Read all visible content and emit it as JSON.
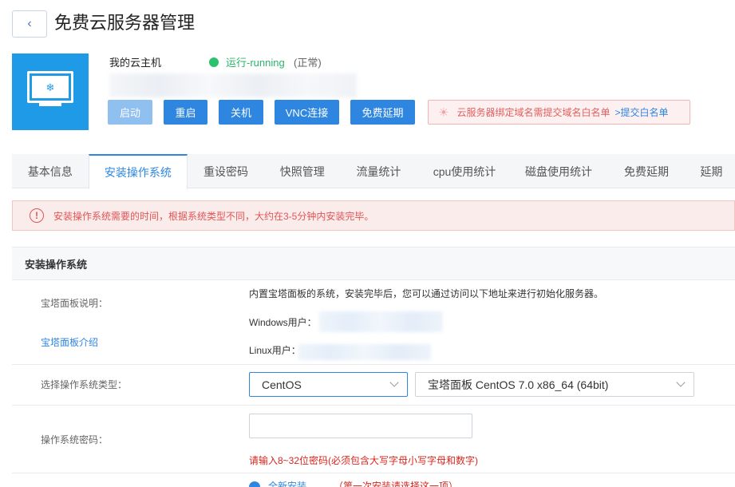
{
  "header": {
    "back_icon": "‹",
    "title": "免费云服务器管理"
  },
  "server": {
    "name": "我的云主机",
    "status": "运行-running",
    "status_note": "(正常)",
    "status_color": "#2bc26e"
  },
  "actions": {
    "start": "启动",
    "restart": "重启",
    "shutdown": "关机",
    "vnc": "VNC连接",
    "extend": "免费延期"
  },
  "notice": {
    "text": "云服务器绑定域名需提交域名白名单",
    "link": ">提交白名单"
  },
  "tabs": [
    {
      "label": "基本信息"
    },
    {
      "label": "安装操作系统",
      "active": true
    },
    {
      "label": "重设密码"
    },
    {
      "label": "快照管理"
    },
    {
      "label": "流量统计"
    },
    {
      "label": "cpu使用统计"
    },
    {
      "label": "磁盘使用统计"
    },
    {
      "label": "免费延期"
    },
    {
      "label": "延期"
    }
  ],
  "alert": {
    "icon": "!",
    "text": "安装操作系统需要的时间，根据系统类型不同，大约在3-5分钟内安装完毕。"
  },
  "section": {
    "title": "安装操作系统",
    "panel": {
      "label": "宝塔面板说明：",
      "link": "宝塔面板介绍",
      "desc": "内置宝塔面板的系统，安装完毕后，您可以通过访问以下地址来进行初始化服务器。",
      "windows_label": "Windows用户：",
      "linux_label": "Linux用户："
    },
    "os_type": {
      "label": "选择操作系统类型：",
      "selected": "CentOS",
      "version": "宝塔面板 CentOS 7.0 x86_64 (64bit)"
    },
    "password": {
      "label": "操作系统密码：",
      "value": "",
      "hint": "请输入8~32位密码(必须包含大写字母小写字母和数字)"
    },
    "install_mode": {
      "option": "全新安装",
      "note": "（第一次安装请选择这一项）"
    }
  },
  "colors": {
    "accent": "#2e86e0",
    "server_tile": "#1e9ae6",
    "error": "#d9251c"
  }
}
